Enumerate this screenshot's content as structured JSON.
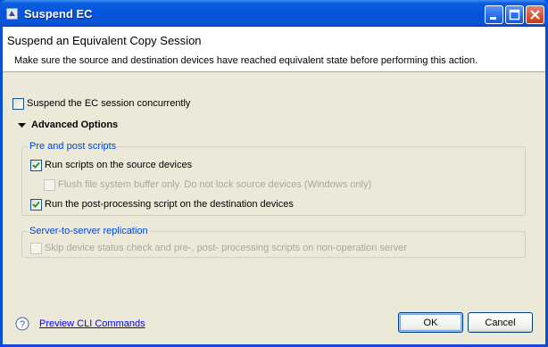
{
  "window": {
    "title": "Suspend EC",
    "controls": [
      "minimize-icon",
      "maximize-icon",
      "close-icon"
    ]
  },
  "header": {
    "title": "Suspend an Equivalent Copy Session",
    "description": "Make sure the source and destination devices have reached equivalent state before performing this action."
  },
  "options": {
    "concurrent": {
      "label": "Suspend the EC session concurrently",
      "checked": false
    },
    "advanced_label": "Advanced Options"
  },
  "scripts_group": {
    "title": "Pre and post scripts",
    "run_source": {
      "label": "Run scripts on the source devices",
      "checked": true
    },
    "flush_only": {
      "label": "Flush file system buffer only. Do not lock source devices (Windows only)",
      "checked": false,
      "enabled": false
    },
    "run_post": {
      "label": "Run the post-processing script on the destination devices",
      "checked": true
    }
  },
  "replication_group": {
    "title": "Server-to-server replication",
    "skip_check": {
      "label": "Skip device status check and pre-, post- processing scripts on non-operation server",
      "checked": false,
      "enabled": false
    }
  },
  "footer": {
    "link": "Preview CLI Commands",
    "ok_label": "OK",
    "cancel_label": "Cancel"
  }
}
